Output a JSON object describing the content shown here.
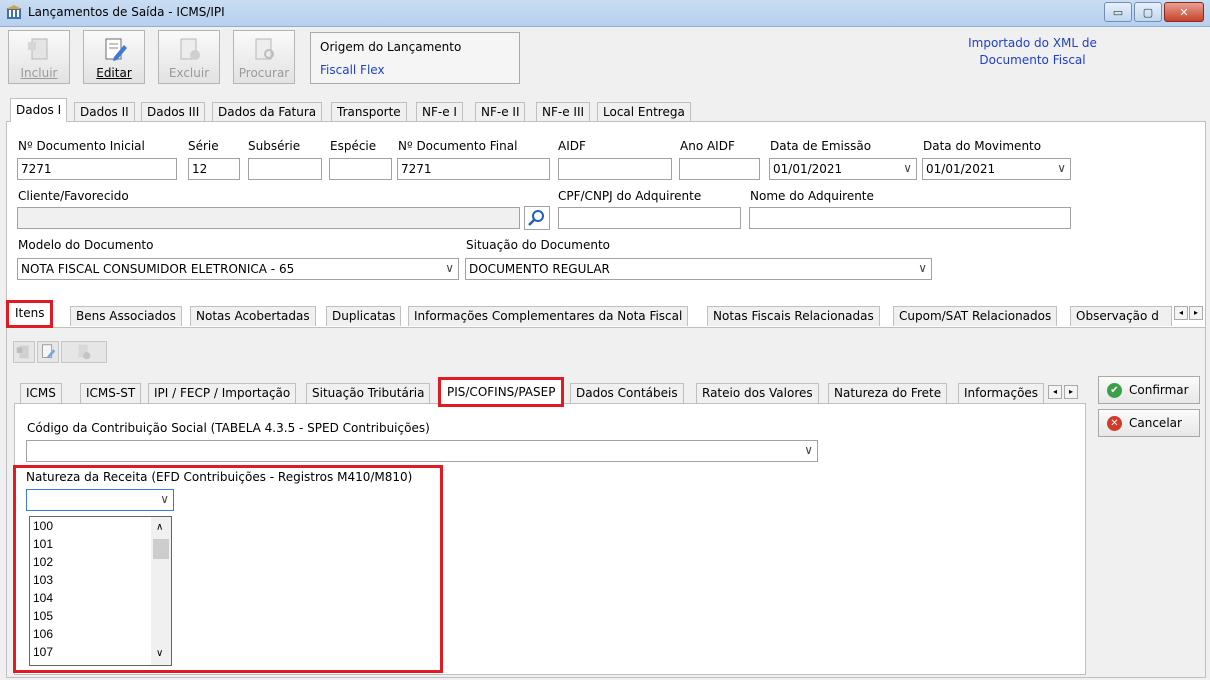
{
  "window": {
    "title": "Lançamentos de Saída - ICMS/IPI",
    "btn_min": "▭",
    "btn_max": "▢",
    "btn_close": "✕"
  },
  "toolbar": {
    "incluir": "Incluir",
    "editar": "Editar",
    "excluir": "Excluir",
    "procurar": "Procurar"
  },
  "origin": {
    "label": "Origem do Lançamento",
    "value": "Fiscall Flex"
  },
  "notice": {
    "line1": "Importado do XML de",
    "line2": "Documento Fiscal"
  },
  "main_tabs": [
    "Dados I",
    "Dados II",
    "Dados III",
    "Dados da Fatura",
    "Transporte",
    "NF-e I",
    "NF-e II",
    "NF-e III",
    "Local Entrega"
  ],
  "form": {
    "doc_inicial_label": "Nº Documento Inicial",
    "doc_inicial_value": "7271",
    "serie_label": "Série",
    "serie_value": "12",
    "subserie_label": "Subsérie",
    "subserie_value": "",
    "especie_label": "Espécie",
    "especie_value": "",
    "doc_final_label": "Nº Documento Final",
    "doc_final_value": "7271",
    "aidf_label": "AIDF",
    "aidf_value": "",
    "ano_aidf_label": "Ano AIDF",
    "ano_aidf_value": "",
    "data_emissao_label": "Data de Emissão",
    "data_emissao_value": "01/01/2021",
    "data_movimento_label": "Data do Movimento",
    "data_movimento_value": "01/01/2021",
    "cliente_label": "Cliente/Favorecido",
    "cliente_value": "",
    "cpf_label": "CPF/CNPJ do Adquirente",
    "cpf_value": "",
    "nome_adq_label": "Nome do Adquirente",
    "nome_adq_value": "",
    "modelo_label": "Modelo do Documento",
    "modelo_value": "NOTA FISCAL CONSUMIDOR ELETRONICA - 65",
    "situacao_label": "Situação do Documento",
    "situacao_value": "DOCUMENTO REGULAR"
  },
  "sub_tabs": [
    "Itens",
    "Bens Associados",
    "Notas Acobertadas",
    "Duplicatas",
    "Informações Complementares da Nota Fiscal",
    "Notas Fiscais Relacionadas",
    "Cupom/SAT Relacionados",
    "Observação d"
  ],
  "item_tabs": [
    "ICMS",
    "ICMS-ST",
    "IPI / FECP / Importação",
    "Situação Tributária",
    "PIS/COFINS/PASEP",
    "Dados Contábeis",
    "Rateio dos Valores",
    "Natureza do Frete",
    "Informações"
  ],
  "pis": {
    "codigo_label": "Código da Contribuição Social (TABELA 4.3.5 - SPED Contribuições)",
    "codigo_value": "",
    "natureza_label": "Natureza da Receita (EFD Contribuições - Registros M410/M810)",
    "natureza_value": "",
    "natureza_options": [
      "100",
      "101",
      "102",
      "103",
      "104",
      "105",
      "106",
      "107"
    ]
  },
  "actions": {
    "confirmar": "Confirmar",
    "cancelar": "Cancelar"
  },
  "glyphs": {
    "chevron": "∨",
    "left": "◂",
    "right": "▸",
    "up": "▲",
    "down": "▼",
    "check": "✔",
    "x": "✕"
  },
  "colors": {
    "highlight": "#e01b24",
    "link_blue": "#1f3fcc",
    "confirm_green": "#3aa04a",
    "cancel_red": "#d23b2c"
  }
}
